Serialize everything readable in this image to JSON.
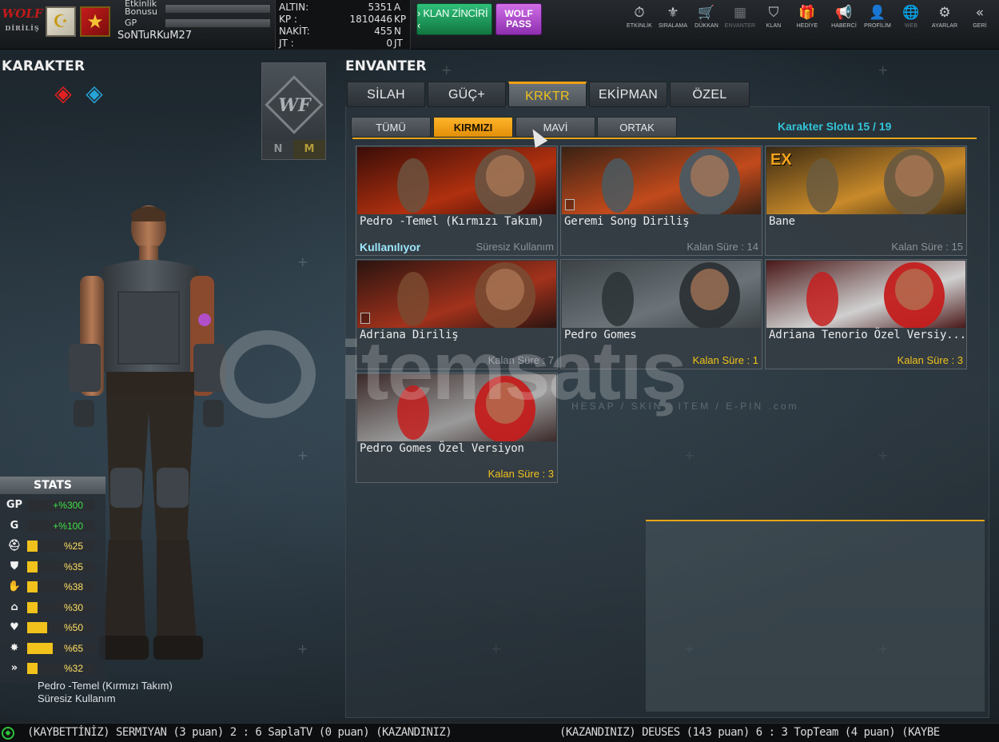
{
  "topbar": {
    "bonus_label": "Etkinlik Bonusu",
    "gp_label": "GP",
    "username": "SoNTuRKuM27",
    "currency": [
      {
        "key": "ALTIN:",
        "value": "5351",
        "unit": "A"
      },
      {
        "key": "KP :",
        "value": "1810446",
        "unit": "KP"
      },
      {
        "key": "NAKİT:",
        "value": "455",
        "unit": "N"
      },
      {
        "key": "JT :",
        "value": "0",
        "unit": "JT"
      }
    ],
    "klan_zinciri": "› KLAN ZİNCİRİ ‹",
    "wolf_pass_line1": "WOLF",
    "wolf_pass_line2": "PASS",
    "nav": [
      {
        "label": "ETKİNLİK",
        "icon": "stopwatch-icon",
        "glyph": "⏱"
      },
      {
        "label": "SIRALAMA",
        "icon": "ranking-icon",
        "glyph": "⚜"
      },
      {
        "label": "DÜKKAN",
        "icon": "cart-icon",
        "glyph": "🛒"
      },
      {
        "label": "ENVANTER",
        "icon": "inventory-icon",
        "glyph": "▦"
      },
      {
        "label": "KLAN",
        "icon": "shield-icon",
        "glyph": "⛉"
      },
      {
        "label": "HEDİYE",
        "icon": "gift-icon",
        "glyph": "🎁"
      },
      {
        "label": "HABERCİ",
        "icon": "megaphone-icon",
        "glyph": "📢"
      },
      {
        "label": "PROFİLİM",
        "icon": "profile-icon",
        "glyph": "👤"
      },
      {
        "label": "WEB",
        "icon": "globe-icon",
        "glyph": "🌐"
      },
      {
        "label": "AYARLAR",
        "icon": "gear-icon",
        "glyph": "⚙"
      },
      {
        "label": "GERİ",
        "icon": "back-icon",
        "glyph": "«"
      }
    ]
  },
  "left": {
    "title": "KARAKTER",
    "wf_n": "N",
    "wf_m": "M",
    "stats_title": "STATS",
    "stats": [
      {
        "icon": "gp-icon",
        "glyph": "GP",
        "value": "+%300",
        "level": 0,
        "green": true
      },
      {
        "icon": "gold-icon",
        "glyph": "G",
        "value": "+%100",
        "level": 0,
        "green": true
      },
      {
        "icon": "helmet-icon",
        "glyph": "⛑",
        "value": "%25",
        "level": 0.15,
        "green": false
      },
      {
        "icon": "armor-icon",
        "glyph": "⛊",
        "value": "%35",
        "level": 0.15,
        "green": false
      },
      {
        "icon": "gloves-icon",
        "glyph": "✋",
        "value": "%38",
        "level": 0.15,
        "green": false
      },
      {
        "icon": "boots-icon",
        "glyph": "⌂",
        "value": "%30",
        "level": 0.15,
        "green": false
      },
      {
        "icon": "heart-icon",
        "glyph": "♥",
        "value": "%50",
        "level": 0.3,
        "green": false
      },
      {
        "icon": "burst-icon",
        "glyph": "✸",
        "value": "%65",
        "level": 0.38,
        "green": false
      },
      {
        "icon": "speed-icon",
        "glyph": "»",
        "value": "%32",
        "level": 0.16,
        "green": false
      }
    ],
    "character_name": "Pedro -Temel (Kırmızı Takım)",
    "character_duration": "Süresiz Kullanım"
  },
  "inventory": {
    "title": "ENVANTER",
    "main_tabs": [
      "SİLAH",
      "GÜÇ+",
      "KRKTR",
      "EKİPMAN",
      "ÖZEL"
    ],
    "active_main_tab": 2,
    "sub_tabs": [
      "TÜMÜ",
      "KIRMIZI",
      "MAVİ",
      "ORTAK"
    ],
    "active_sub_tab": 1,
    "slot_label": "Karakter Slotu 15 / 19",
    "cards": [
      {
        "title": "Pedro -Temel (Kırmızı Takım)",
        "status": "Kullanılıyor",
        "time": "Süresiz Kullanım",
        "gold": false,
        "ex": "",
        "checkbox": false
      },
      {
        "title": "Geremi Song Diriliş",
        "status": "",
        "time": "Kalan Süre : 14",
        "gold": false,
        "ex": "",
        "checkbox": true
      },
      {
        "title": "Bane",
        "status": "",
        "time": "Kalan Süre : 15",
        "gold": false,
        "ex": "EX",
        "checkbox": false
      },
      {
        "title": "Adriana Diriliş",
        "status": "",
        "time": "Kalan Süre : 7",
        "gold": false,
        "ex": "",
        "checkbox": true
      },
      {
        "title": "Pedro Gomes",
        "status": "",
        "time": "Kalan Süre : 1",
        "gold": true,
        "ex": "",
        "checkbox": false
      },
      {
        "title": "Adriana Tenorio Özel Versiy...",
        "status": "",
        "time": "Kalan Süre : 3",
        "gold": true,
        "ex": "",
        "checkbox": false
      },
      {
        "title": "Pedro Gomes Özel Versiyon",
        "status": "",
        "time": "Kalan Süre : 3",
        "gold": true,
        "ex": "",
        "checkbox": false
      }
    ]
  },
  "ticker": {
    "line1": "(KAYBETTİNİZ) SERMIYAN (3 puan) 2 : 6 SaplaTV (0 puan) (KAZANDINIZ)",
    "line2": "(KAZANDINIZ) DEUSES (143 puan) 6 : 3 TopTeam (4 puan) (KAYBE"
  },
  "watermark": {
    "word": "itemsatış",
    "tagline": "HESAP / SKIN / ITEM / E-PIN  .com"
  }
}
